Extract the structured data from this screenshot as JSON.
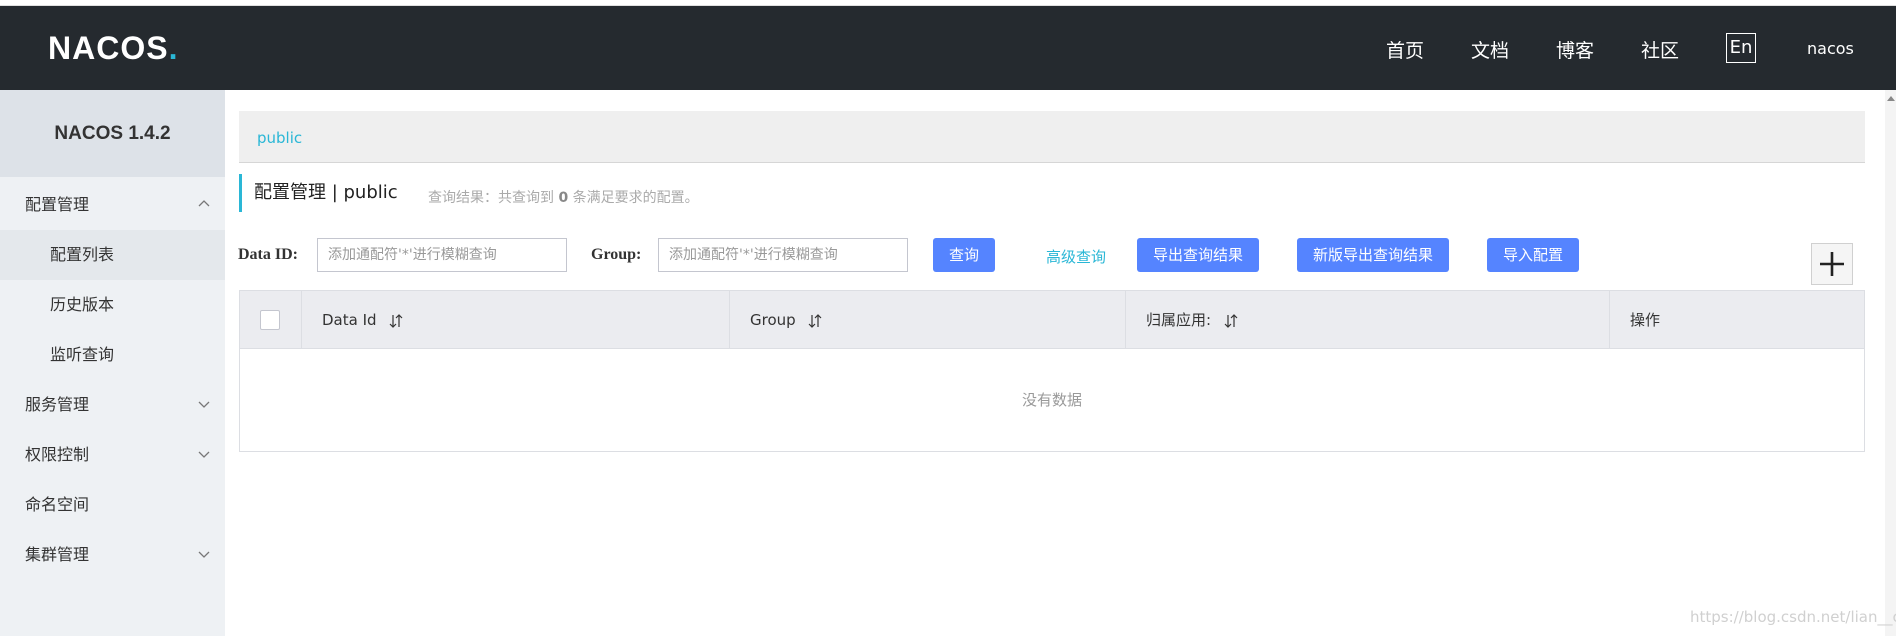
{
  "header": {
    "logo": {
      "left": "NA",
      "middle": "CO",
      "right": "S",
      "dot": "."
    },
    "nav": [
      "首页",
      "文档",
      "博客",
      "社区"
    ],
    "lang": "En",
    "user": "nacos"
  },
  "sidebar": {
    "version": "NACOS 1.4.2",
    "items": [
      {
        "label": "配置管理"
      },
      {
        "label": "配置列表"
      },
      {
        "label": "历史版本"
      },
      {
        "label": "监听查询"
      },
      {
        "label": "服务管理"
      },
      {
        "label": "权限控制"
      },
      {
        "label": "命名空间"
      },
      {
        "label": "集群管理"
      }
    ]
  },
  "main": {
    "namespace": "public",
    "title": "配置管理 | public",
    "summary_prefix": "查询结果：共查询到",
    "summary_count": "0",
    "summary_suffix": "条满足要求的配置。",
    "search": {
      "dataid_label": "Data ID:",
      "dataid_placeholder": "添加通配符'*'进行模糊查询",
      "group_label": "Group:",
      "group_placeholder": "添加通配符'*'进行模糊查询",
      "query_button": "查询",
      "advanced_link": "高级查询",
      "export_button": "导出查询结果",
      "export_new_button": "新版导出查询结果",
      "import_button": "导入配置"
    },
    "table": {
      "columns": [
        "Data Id",
        "Group",
        "归属应用:",
        "操作"
      ],
      "empty": "没有数据"
    }
  },
  "watermark": "https://blog.csdn.net/lian__c",
  "colors": {
    "header_bg": "#252a2f",
    "accent": "#2ab7d6",
    "button": "#5584ff",
    "sidebar_bg": "#eef1f4"
  }
}
